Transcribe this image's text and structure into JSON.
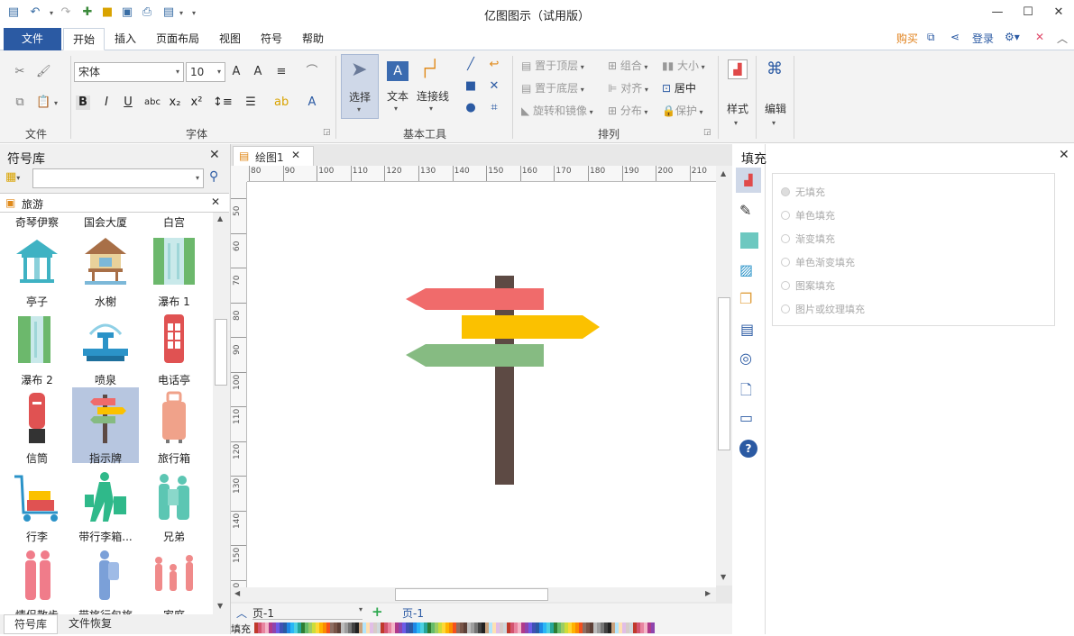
{
  "app": {
    "title": "亿图图示（试用版）"
  },
  "menu": {
    "file": "文件",
    "tabs": [
      "开始",
      "插入",
      "页面布局",
      "视图",
      "符号",
      "帮助"
    ],
    "buy": "购买",
    "login": "登录"
  },
  "ribbon": {
    "font_name": "宋体",
    "font_size": "10",
    "group_file": "文件",
    "group_font": "字体",
    "group_tools": "基本工具",
    "group_arrange": "排列",
    "select": "选择",
    "text": "文本",
    "connector": "连接线",
    "bring_front": "置于顶层",
    "send_back": "置于底层",
    "rotate": "旋转和镜像",
    "group": "组合",
    "align": "对齐",
    "distribute": "分布",
    "size": "大小",
    "center": "居中",
    "protect": "保护",
    "style": "样式",
    "edit": "编辑"
  },
  "library": {
    "title": "符号库",
    "category": "旅游",
    "partial_top": [
      "奇琴伊察",
      "国会大厦",
      "白宫"
    ],
    "items": [
      "亭子",
      "水榭",
      "瀑布 1",
      "瀑布 2",
      "喷泉",
      "电话亭",
      "信筒",
      "指示牌",
      "旅行箱",
      "行李",
      "带行李箱...",
      "兄弟"
    ],
    "partial_bottom": [
      "情侣散步",
      "带旅行包旅行",
      "家庭"
    ],
    "selected": "指示牌",
    "bottom_tabs": [
      "符号库",
      "文件恢复"
    ]
  },
  "document": {
    "tab": "绘图1",
    "ruler_top": [
      "80",
      "90",
      "100",
      "110",
      "120",
      "130",
      "140",
      "150",
      "160",
      "170",
      "180",
      "190",
      "200",
      "210"
    ],
    "ruler_left": [
      "50",
      "60",
      "70",
      "80",
      "90",
      "100",
      "110",
      "120",
      "130",
      "140",
      "150",
      "160"
    ],
    "page_selector": "页-1",
    "page_tab": "页-1",
    "fill_label": "填充"
  },
  "signpost": {
    "post": "#5d4a44",
    "arrow1": "#f06b6b",
    "arrow2": "#fbc100",
    "arrow3": "#86bb82"
  },
  "fill_panel": {
    "title": "填充",
    "options": [
      "无填充",
      "单色填充",
      "渐变填充",
      "单色渐变填充",
      "图案填充",
      "图片或纹理填充"
    ]
  },
  "colors": {
    "accent": "#2b5aa3",
    "selected": "#b7c6e0",
    "buy": "#e0801a"
  }
}
